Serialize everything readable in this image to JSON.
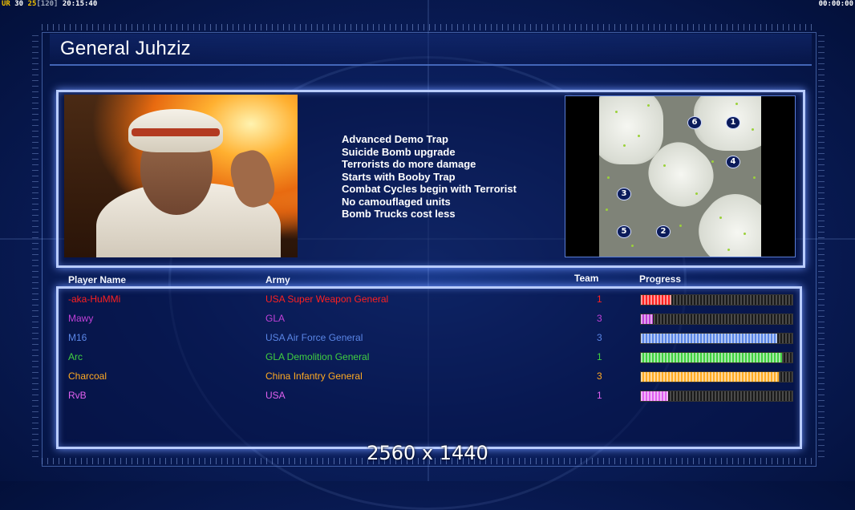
{
  "hud": {
    "left_ur": "UR",
    "left_n1": "30",
    "left_n2": "25",
    "left_bracket": "[120]",
    "left_time": "20:15:40",
    "right_time": "00:00:00"
  },
  "general": {
    "title": "General Juhziz",
    "traits": [
      "Advanced Demo Trap",
      "Suicide Bomb upgrade",
      "Terrorists do more damage",
      "Starts with Booby Trap",
      "Combat Cycles begin with Terrorist",
      "No camouflaged units",
      "Bomb Trucks cost less"
    ]
  },
  "minimap": {
    "markers": [
      "6",
      "1",
      "4",
      "3",
      "5",
      "2"
    ]
  },
  "table": {
    "headers": {
      "name": "Player Name",
      "army": "Army",
      "team": "Team",
      "progress": "Progress"
    },
    "players": [
      {
        "name": "-aka-HuMMi",
        "army": "USA Super Weapon General",
        "team": "1",
        "color": "#ff2020",
        "progress": 0.2
      },
      {
        "name": "Mawy",
        "army": "GLA",
        "team": "3",
        "color": "#c040d8",
        "progress": 0.08
      },
      {
        "name": "M16",
        "army": "USA Air Force General",
        "team": "3",
        "color": "#5a86e6",
        "progress": 0.9
      },
      {
        "name": "Arc",
        "army": "GLA Demolition General",
        "team": "1",
        "color": "#40d040",
        "progress": 0.93
      },
      {
        "name": "Charcoal",
        "army": "China Infantry General",
        "team": "3",
        "color": "#ffaa22",
        "progress": 0.91
      },
      {
        "name": "RvB",
        "army": "USA",
        "team": "1",
        "color": "#e060f0",
        "progress": 0.18
      }
    ]
  },
  "resolution_label": "2560 x 1440"
}
